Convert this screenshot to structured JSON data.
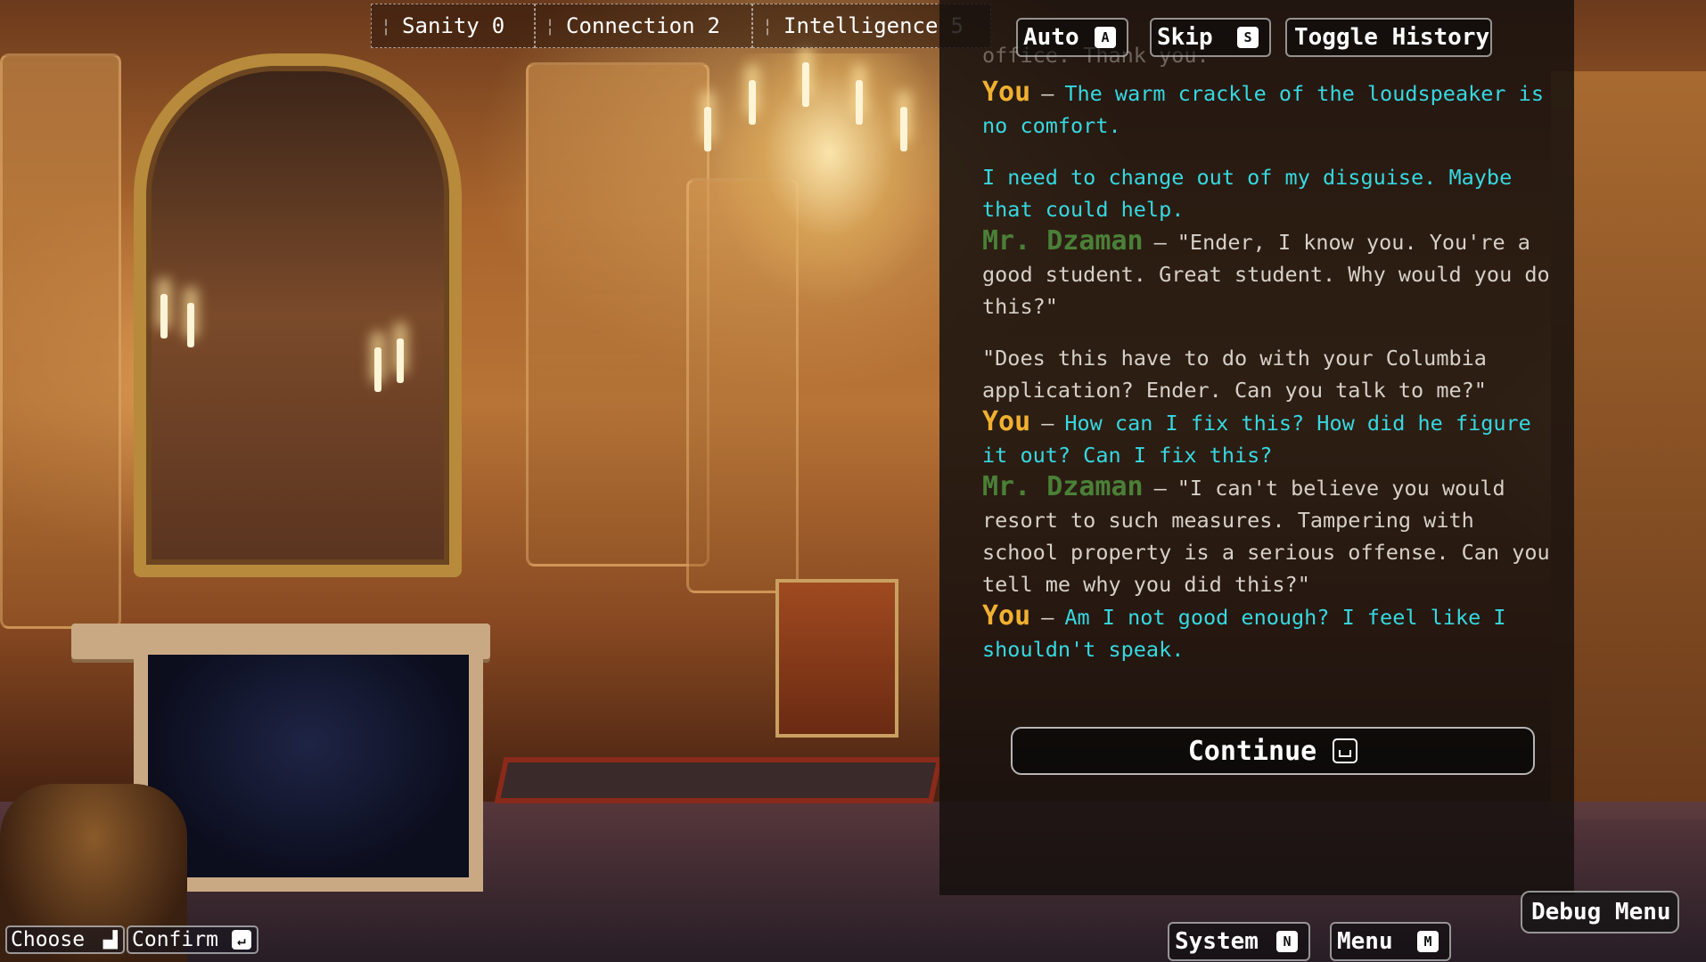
{
  "stats": [
    {
      "label": "Sanity",
      "value": "0"
    },
    {
      "label": "Connection",
      "value": "2"
    },
    {
      "label": "Intelligence",
      "value": "5"
    }
  ],
  "controls": {
    "auto": {
      "label": "Auto",
      "key": "A"
    },
    "skip": {
      "label": "Skip",
      "key": "S"
    },
    "history": {
      "label": "Toggle History"
    }
  },
  "dialog": {
    "faded_line": "office. Thank you.",
    "entries": [
      {
        "speaker": "You",
        "type": "thought",
        "text": "The warm crackle of the loudspeaker is no comfort.",
        "text2": "I need to change out of my disguise. Maybe that could help."
      },
      {
        "speaker": "Mr. Dzaman",
        "type": "speech",
        "text": "\"Ender, I know you. You're a good student. Great student. Why would you do this?\"",
        "text2": "\"Does this have to do with your Columbia application? Ender. Can you talk to me?\""
      },
      {
        "speaker": "You",
        "type": "thought",
        "text": "How can I fix this? How did he figure it out? Can I fix this?"
      },
      {
        "speaker": "Mr. Dzaman",
        "type": "speech",
        "text": "\"I can't believe you would resort to such measures. Tampering with school property is a serious offense. Can you tell me why you did this?\""
      },
      {
        "speaker": "You",
        "type": "thought",
        "text": "Am I not good enough? I feel like I shouldn't speak."
      }
    ],
    "continue_label": "Continue"
  },
  "bottom": {
    "choose": "Choose",
    "confirm": "Confirm",
    "system": {
      "label": "System",
      "key": "N"
    },
    "menu": {
      "label": "Menu",
      "key": "M"
    },
    "debug": "Debug Menu"
  },
  "colors": {
    "you": "#f0b030",
    "npc": "#4a8038",
    "thought": "#37d8e0"
  }
}
